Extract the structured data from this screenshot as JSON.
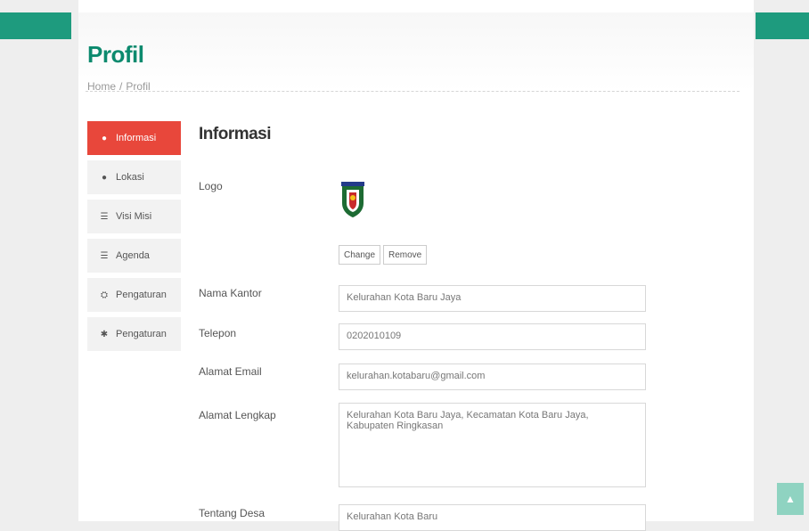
{
  "header": {
    "title": "Profil",
    "breadcrumb": [
      "Home",
      "Profil"
    ],
    "breadcrumb_sep": "/"
  },
  "sidebar": {
    "items": [
      {
        "icon": "info-circle-icon",
        "glyph": "●",
        "label": "Informasi",
        "active": true
      },
      {
        "icon": "map-marker-icon",
        "glyph": "●",
        "label": "Lokasi",
        "active": false
      },
      {
        "icon": "list-icon",
        "glyph": "☰",
        "label": "Visi Misi",
        "active": false
      },
      {
        "icon": "list-icon",
        "glyph": "☰",
        "label": "Agenda",
        "active": false
      },
      {
        "icon": "users-icon",
        "glyph": "⛭",
        "label": "Pengaturan",
        "active": false
      },
      {
        "icon": "gear-icon",
        "glyph": "✱",
        "label": "Pengaturan",
        "active": false
      }
    ]
  },
  "form": {
    "section_title": "Informasi",
    "logo_label": "Logo",
    "change_label": "Change",
    "remove_label": "Remove",
    "nama_kantor_label": "Nama Kantor",
    "nama_kantor_value": "Kelurahan Kota Baru Jaya",
    "telepon_label": "Telepon",
    "telepon_value": "0202010109",
    "email_label": "Alamat Email",
    "email_value": "kelurahan.kotabaru@gmail.com",
    "alamat_label": "Alamat Lengkap",
    "alamat_value": "Kelurahan Kota Baru Jaya, Kecamatan Kota Baru Jaya, Kabupaten Ringkasan",
    "tentang_label": "Tentang Desa",
    "tentang_value": "Kelurahan Kota Baru"
  },
  "colors": {
    "accent": "#1e9b7e",
    "active": "#e8473b"
  }
}
